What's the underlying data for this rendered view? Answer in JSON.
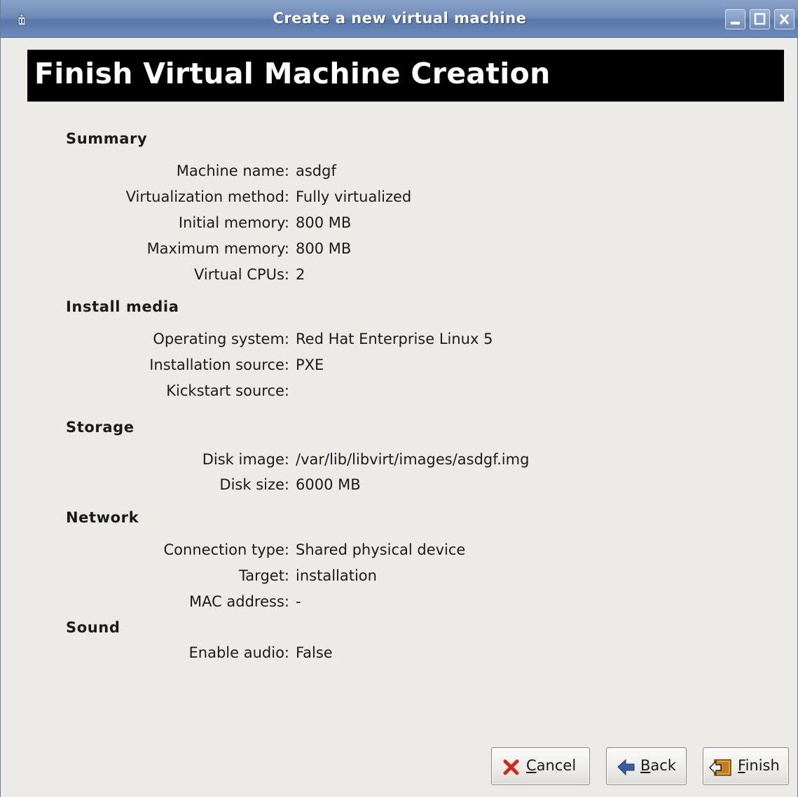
{
  "window": {
    "title": "Create a new virtual machine"
  },
  "header": {
    "title": "Finish Virtual Machine Creation"
  },
  "summary": {
    "heading": "Summary",
    "rows": [
      {
        "label": "Machine name:",
        "value": "asdgf"
      },
      {
        "label": "Virtualization method:",
        "value": "Fully virtualized"
      },
      {
        "label": "Initial memory:",
        "value": "800 MB"
      },
      {
        "label": "Maximum memory:",
        "value": "800 MB"
      },
      {
        "label": "Virtual CPUs:",
        "value": "2"
      }
    ]
  },
  "install_media": {
    "heading": "Install media",
    "rows": [
      {
        "label": "Operating system:",
        "value": "Red Hat Enterprise Linux 5"
      },
      {
        "label": "Installation source:",
        "value": "PXE"
      },
      {
        "label": "Kickstart source:",
        "value": ""
      }
    ]
  },
  "storage": {
    "heading": "Storage",
    "rows": [
      {
        "label": "Disk image:",
        "value": "/var/lib/libvirt/images/asdgf.img"
      },
      {
        "label": "Disk size:",
        "value": "6000 MB"
      }
    ]
  },
  "network": {
    "heading": "Network",
    "rows": [
      {
        "label": "Connection type:",
        "value": "Shared physical device"
      },
      {
        "label": "Target:",
        "value": "installation"
      },
      {
        "label": "MAC address:",
        "value": "-"
      }
    ]
  },
  "sound": {
    "heading": "Sound",
    "rows": [
      {
        "label": "Enable audio:",
        "value": "False"
      }
    ]
  },
  "buttons": {
    "cancel": {
      "mnemonic": "C",
      "rest": "ancel",
      "icon": "cancel-x-icon"
    },
    "back": {
      "mnemonic": "B",
      "rest": "ack",
      "icon": "back-arrow-icon"
    },
    "finish": {
      "mnemonic": "F",
      "rest": "inish",
      "icon": "finish-icon"
    }
  },
  "colors": {
    "titlebar": "#6f8bb8",
    "background": "#edebe7",
    "header_bg": "#000000",
    "header_fg": "#ffffff",
    "cancel_icon": "#d0281c",
    "back_icon": "#3a5fa0"
  }
}
